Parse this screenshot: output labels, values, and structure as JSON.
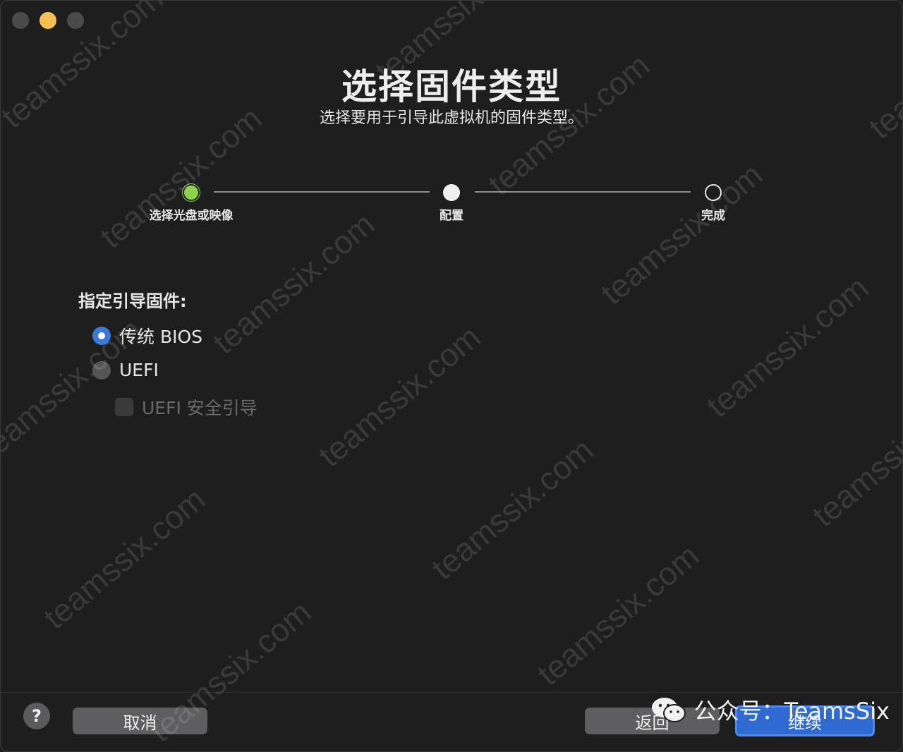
{
  "window": {
    "title": "选择固件类型",
    "subtitle": "选择要用于引导此虚拟机的固件类型。"
  },
  "steps": [
    {
      "label": "选择光盘或映像",
      "state": "done",
      "color": "#8fd14f"
    },
    {
      "label": "配置",
      "state": "active"
    },
    {
      "label": "完成",
      "state": "future"
    }
  ],
  "firmware": {
    "section_label": "指定引导固件:",
    "options": [
      {
        "label": "传统 BIOS",
        "selected": true
      },
      {
        "label": "UEFI",
        "selected": false
      }
    ],
    "secure_boot_label": "UEFI 安全引导",
    "secure_boot_checked": false,
    "secure_boot_enabled": false
  },
  "footer": {
    "help_label": "?",
    "cancel_label": "取消",
    "back_label": "返回",
    "continue_label": "继续",
    "accent": "#2f6ad3"
  },
  "watermark": {
    "text": "teamssix.com",
    "wechat_label": "公众号：TeamsSix"
  }
}
